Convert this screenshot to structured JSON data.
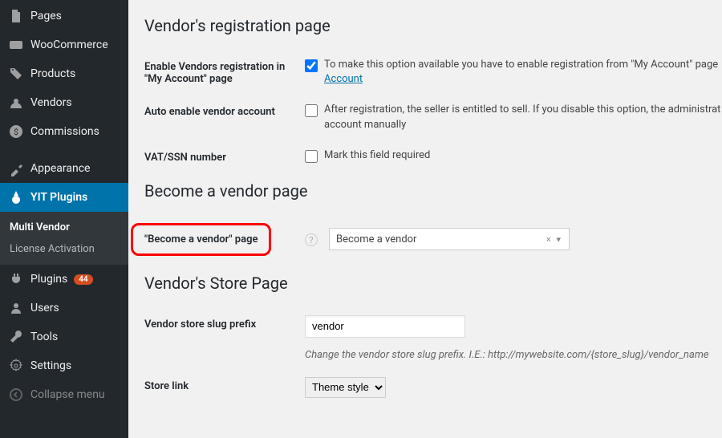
{
  "sidebar": {
    "pages": "Pages",
    "woocommerce": "WooCommerce",
    "products": "Products",
    "vendors": "Vendors",
    "commissions": "Commissions",
    "appearance": "Appearance",
    "yit_plugins": "YIT Plugins",
    "sub_multi_vendor": "Multi Vendor",
    "sub_license": "License Activation",
    "plugins": "Plugins",
    "plugins_badge": "44",
    "users": "Users",
    "tools": "Tools",
    "settings": "Settings",
    "collapse": "Collapse menu"
  },
  "sections": {
    "reg_title": "Vendor's registration page",
    "become_title": "Become a vendor page",
    "store_title": "Vendor's Store Page"
  },
  "rows": {
    "enable_reg_label": "Enable Vendors registration in \"My Account\" page",
    "enable_reg_desc": "To make this option available you have to enable registration from \"My Account\" page ",
    "enable_reg_link": "Account",
    "auto_enable_label": "Auto enable vendor account",
    "auto_enable_desc": "After registration, the seller is entitled to sell. If you disable this option, the administrat account manually",
    "vat_label": "VAT/SSN number",
    "vat_desc": "Mark this field required",
    "become_label": "\"Become a vendor\" page",
    "become_value": "Become a vendor",
    "slug_label": "Vendor store slug prefix",
    "slug_value": "vendor",
    "slug_hint": "Change the vendor store slug prefix. I.E.: http://mywebsite.com/{store_slug}/vendor_name",
    "storelink_label": "Store link",
    "storelink_value": "Theme style"
  }
}
